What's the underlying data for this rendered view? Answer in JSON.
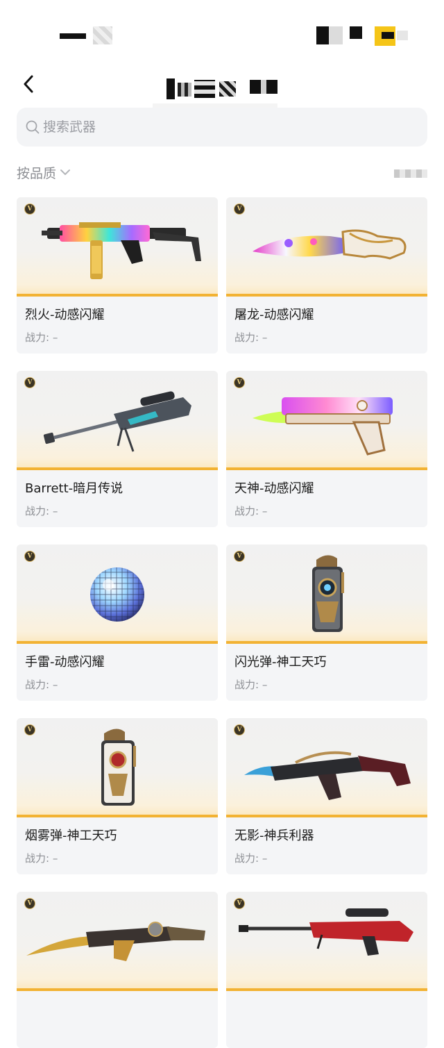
{
  "search": {
    "placeholder": "搜索武器"
  },
  "filter": {
    "label": "按品质"
  },
  "badge_text": "V",
  "colors": {
    "accent_bar": "#f2b233",
    "card_bg": "#f4f5f7",
    "muted_text": "#8c8e93"
  },
  "weapons": [
    {
      "name": "烈火-动感闪耀",
      "power": "战力: –",
      "art": "smg-icon"
    },
    {
      "name": "屠龙-动感闪耀",
      "power": "战力: –",
      "art": "knife-icon"
    },
    {
      "name": "Barrett-暗月传说",
      "power": "战力: –",
      "art": "sniper-rifle-icon"
    },
    {
      "name": "天神-动感闪耀",
      "power": "战力: –",
      "art": "pistol-icon"
    },
    {
      "name": "手雷-动感闪耀",
      "power": "战力: –",
      "art": "disco-grenade-icon"
    },
    {
      "name": "闪光弹-神工天巧",
      "power": "战力: –",
      "art": "flashbang-icon"
    },
    {
      "name": "烟雾弹-神工天巧",
      "power": "战力: –",
      "art": "smoke-grenade-icon"
    },
    {
      "name": "无影-神兵利器",
      "power": "战力: –",
      "art": "assault-rifle-icon"
    },
    {
      "name": "",
      "power": "",
      "art": "golden-rifle-icon"
    },
    {
      "name": "",
      "power": "",
      "art": "red-sniper-icon"
    }
  ]
}
